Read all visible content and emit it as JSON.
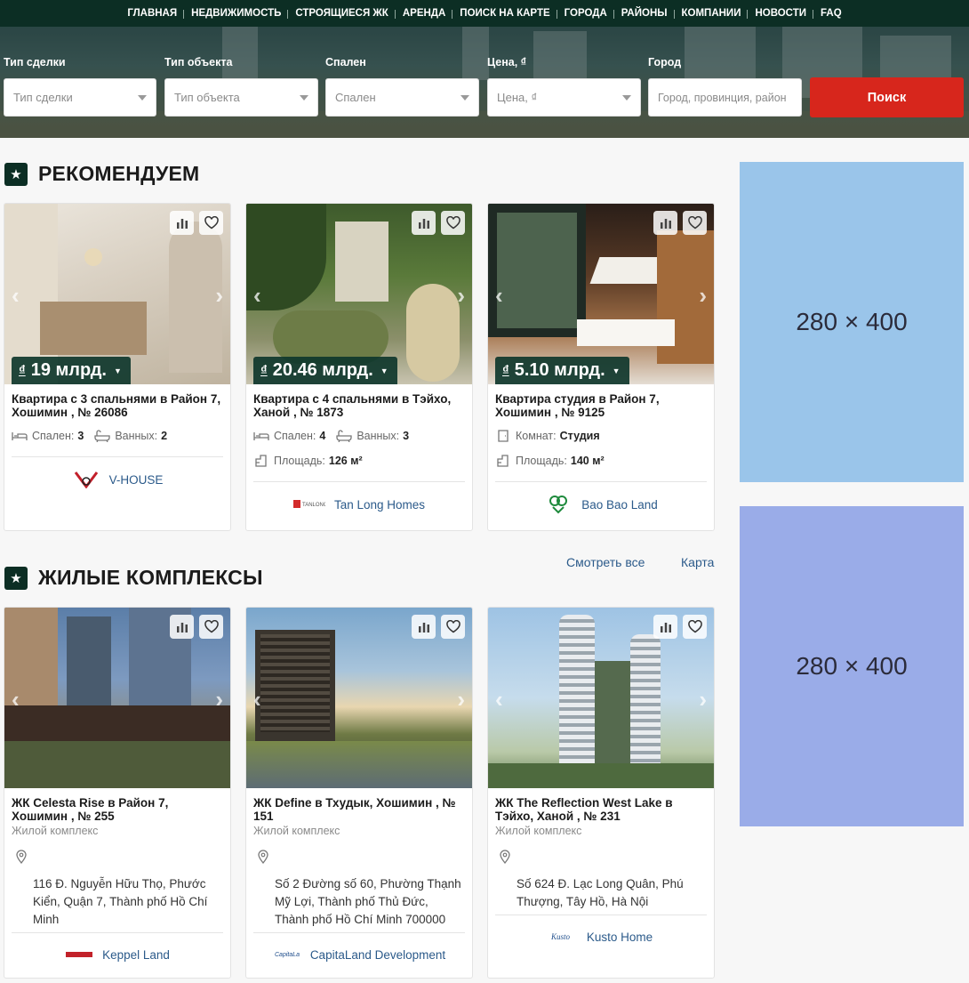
{
  "nav": [
    "ГЛАВНАЯ",
    "НЕДВИЖИМОСТЬ",
    "СТРОЯЩИЕСЯ ЖК",
    "АРЕНДА",
    "ПОИСК НА КАРТЕ",
    "ГОРОДА",
    "РАЙОНЫ",
    "КОМПАНИИ",
    "НОВОСТИ",
    "FAQ"
  ],
  "filters": {
    "deal_type": {
      "label": "Тип сделки",
      "placeholder": "Тип сделки"
    },
    "object_type": {
      "label": "Тип объекта",
      "placeholder": "Тип объекта"
    },
    "bedrooms": {
      "label": "Спален",
      "placeholder": "Спален"
    },
    "price": {
      "label": "Цена, ₫",
      "placeholder": "Цена, ₫"
    },
    "city": {
      "label": "Город",
      "placeholder": "Город, провинция, район"
    },
    "search_button": "Поиск"
  },
  "recommended": {
    "title": "РЕКОМЕНДУЕМ",
    "cards": [
      {
        "price_symbol": "₫",
        "price": "19 млрд.",
        "title": "Квартира с 3 спальнями в Район 7, Хошимин , № 26086",
        "bedrooms_label": "Спален:",
        "bedrooms": "3",
        "baths_label": "Ванных:",
        "baths": "2",
        "company": "V-HOUSE"
      },
      {
        "price_symbol": "₫",
        "price": "20.46 млрд.",
        "title": "Квартира с 4 спальнями в Тэйхо, Ханой , № 1873",
        "bedrooms_label": "Спален:",
        "bedrooms": "4",
        "baths_label": "Ванных:",
        "baths": "3",
        "area_label": "Площадь:",
        "area": "126 м²",
        "company": "Tan Long Homes"
      },
      {
        "price_symbol": "₫",
        "price": "5.10 млрд.",
        "title": "Квартира студия в Район 7, Хошимин , № 9125",
        "rooms_label": "Комнат:",
        "rooms": "Студия",
        "area_label": "Площадь:",
        "area": "140 м²",
        "company": "Bao Bao Land"
      }
    ]
  },
  "complexes": {
    "title": "ЖИЛЫЕ КОМПЛЕКСЫ",
    "see_all": "Смотреть все",
    "map": "Карта",
    "cards": [
      {
        "title": "ЖК Celesta Rise в Район 7, Хошимин , № 255",
        "subtitle": "Жилой комплекс",
        "address": "116 Đ. Nguyễn Hữu Thọ, Phước Kiển, Quận 7, Thành phố Hồ Chí Minh",
        "company": "Keppel Land"
      },
      {
        "title": "ЖК Define в Тхудык, Хошимин , № 151",
        "subtitle": "Жилой комплекс",
        "address": "Số 2 Đường số 60, Phường Thạnh Mỹ Lợi, Thành phố Thủ Đức, Thành phố Hồ Chí Minh 700000",
        "company": "CapitaLand Development"
      },
      {
        "title": "ЖК The Reflection West Lake в Тэйхо, Ханой , № 231",
        "subtitle": "Жилой комплекс",
        "address": "Số 624 Đ. Lạc Long Quân, Phú Thượng, Tây Hồ, Hà Nội",
        "company": "Kusto Home"
      }
    ]
  },
  "ads": [
    {
      "text": "280 × 400",
      "color": "#9ac5ea"
    },
    {
      "text": "280 × 400",
      "color": "#9aace8"
    }
  ]
}
